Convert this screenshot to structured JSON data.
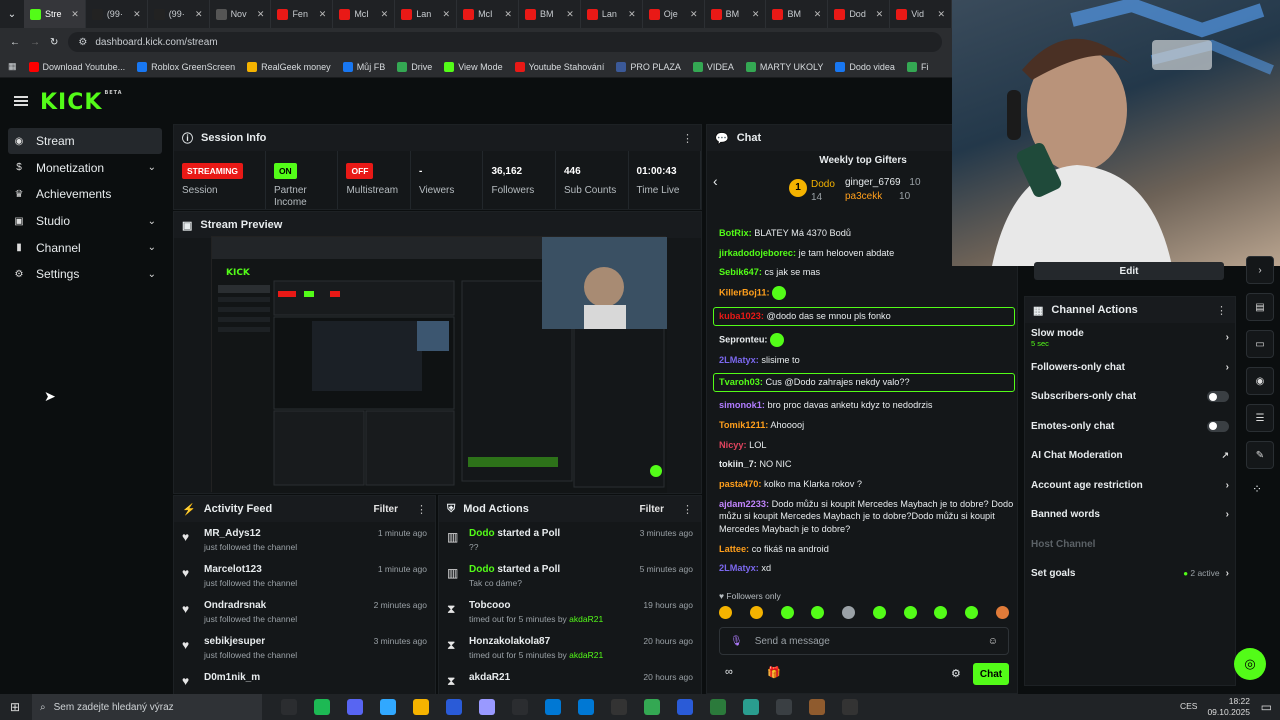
{
  "tabs": [
    "Stre",
    "(99·",
    "(99·",
    "Nov",
    "Fen",
    "McI",
    "Lan",
    "McI",
    "BM",
    "Lan",
    "Oje",
    "BM",
    "BM",
    "Dod",
    "Vid"
  ],
  "address": {
    "url": "dashboard.kick.com/stream"
  },
  "bookmarks": [
    "Download Youtube...",
    "Roblox GreenScreen",
    "RealGeek money",
    "Můj FB",
    "Drive",
    "View Mode",
    "Youtube Stahování",
    "PRO PLAZA",
    "VIDEA",
    "MARTY UKOLY",
    "Dodo videa",
    "Fi"
  ],
  "brand": {
    "logo": "KICK",
    "beta": "BETA",
    "accent": "#53fc18"
  },
  "sidebar": [
    {
      "label": "Stream",
      "chev": false
    },
    {
      "label": "Monetization",
      "chev": true
    },
    {
      "label": "Achievements",
      "chev": false
    },
    {
      "label": "Studio",
      "chev": true
    },
    {
      "label": "Channel",
      "chev": true
    },
    {
      "label": "Settings",
      "chev": true
    }
  ],
  "session": {
    "title": "Session Info",
    "stats": [
      {
        "value": "STREAMING",
        "label": "Session",
        "pill": "#e91916"
      },
      {
        "value": "ON",
        "label": "Partner Income",
        "pill": "#53fc18"
      },
      {
        "value": "OFF",
        "label": "Multistream",
        "pill": "#e91916"
      },
      {
        "value": "-",
        "label": "Viewers"
      },
      {
        "value": "36,162",
        "label": "Followers"
      },
      {
        "value": "446",
        "label": "Sub Counts"
      },
      {
        "value": "01:00:43",
        "label": "Time Live"
      }
    ]
  },
  "preview": {
    "title": "Stream Preview"
  },
  "activity": {
    "title": "Activity Feed",
    "filter": "Filter",
    "items": [
      {
        "name": "MR_Adys12",
        "sub": "just followed the channel",
        "time": "1 minute ago"
      },
      {
        "name": "Marcelot123",
        "sub": "just followed the channel",
        "time": "1 minute ago"
      },
      {
        "name": "Ondradrsnak",
        "sub": "just followed the channel",
        "time": "2 minutes ago"
      },
      {
        "name": "sebikjesuper",
        "sub": "just followed the channel",
        "time": "3 minutes ago"
      },
      {
        "name": "D0m1nik_m",
        "sub": "",
        "time": ""
      }
    ]
  },
  "mod": {
    "title": "Mod Actions",
    "filter": "Filter",
    "items": [
      {
        "icon": "poll",
        "name": "Dodo",
        "verb": "started a Poll",
        "sub": "??",
        "time": "3 minutes ago"
      },
      {
        "icon": "poll",
        "name": "Dodo",
        "verb": "started a Poll",
        "sub": "Tak co dáme?",
        "time": "5 minutes ago"
      },
      {
        "icon": "timer",
        "name": "Tobcooo",
        "verb": "",
        "sub": "timed out for 5 minutes by",
        "by": "akdaR21",
        "time": "19 hours ago"
      },
      {
        "icon": "timer",
        "name": "Honzakolakola87",
        "verb": "",
        "sub": "timed out for 5 minutes by",
        "by": "akdaR21",
        "time": "20 hours ago"
      },
      {
        "icon": "timer",
        "name": "akdaR21",
        "verb": "",
        "sub": "",
        "time": "20 hours ago"
      }
    ]
  },
  "chat": {
    "title": "Chat",
    "gifters_title": "Weekly top Gifters",
    "gifters": [
      {
        "rank": "1",
        "name": "Dodo",
        "count": "14"
      },
      {
        "name": "ginger_6769",
        "count": "10"
      },
      {
        "name": "pa3cekk",
        "count": "10"
      }
    ],
    "messages": [
      {
        "user": "BotRix:",
        "color": "#53fc18",
        "text": "BLATEY Má 4370 Bodů"
      },
      {
        "user": "jirkadodojeborec:",
        "color": "#53fc18",
        "text": "je tam helooven abdate"
      },
      {
        "user": "Sebik647:",
        "color": "#53fc18",
        "text": "cs jak se mas"
      },
      {
        "user": "KillerBoj11:",
        "color": "#ff9f1c",
        "text": "",
        "emote": true
      },
      {
        "user": "kuba1023:",
        "color": "#e91916",
        "text": "@dodo das se mnou pls fonko",
        "hl": true
      },
      {
        "user": "Sepronteu:",
        "color": "#e8ecee",
        "text": "",
        "emote": true
      },
      {
        "user": "2LMatyx:",
        "color": "#7b68ee",
        "text": "slisime to"
      },
      {
        "user": "Tvaroh03:",
        "color": "#53fc18",
        "text": "Cus @Dodo zahrajes nekdy valo??",
        "hl": true
      },
      {
        "user": "simonok1:",
        "color": "#b07cff",
        "text": "bro proc davas anketu kdyz to nedodrzis"
      },
      {
        "user": "Tomik1211:",
        "color": "#ff9f1c",
        "text": "Ahooooj"
      },
      {
        "user": "Nicyy:",
        "color": "#e0445e",
        "text": "LOL"
      },
      {
        "user": "tokiin_7:",
        "color": "#e8ecee",
        "text": "NO NIC"
      },
      {
        "user": "pasta470:",
        "color": "#ff9f1c",
        "text": "kolko ma Klarka rokov ?"
      },
      {
        "user": "ajdam2233:",
        "color": "#c084fc",
        "text": "Dodo můžu si koupit Mercedes Maybach je to dobre? Dodo můžu si koupit Mercedes Maybach je to dobre?Dodo můžu si koupit Mercedes Maybach je to dobre?"
      },
      {
        "user": "Lattee:",
        "color": "#ff9f1c",
        "text": "co fikáš na android"
      },
      {
        "user": "2LMatyx:",
        "color": "#7b68ee",
        "text": "xd"
      }
    ],
    "followers_only": "Followers only",
    "input_placeholder": "Send a message",
    "send_label": "Chat"
  },
  "channel_actions": {
    "edit": "Edit",
    "title": "Channel Actions",
    "items": [
      {
        "label": "Slow mode",
        "sub": "5 sec",
        "right": "chev"
      },
      {
        "label": "Followers-only chat",
        "right": "chev"
      },
      {
        "label": "Subscribers-only chat",
        "right": "toggle"
      },
      {
        "label": "Emotes-only chat",
        "right": "toggle"
      },
      {
        "label": "AI Chat Moderation",
        "right": "ext"
      },
      {
        "label": "Account age restriction",
        "right": "chev"
      },
      {
        "label": "Banned words",
        "right": "chev"
      },
      {
        "label": "Host Channel",
        "right": "",
        "disabled": true
      },
      {
        "label": "Set goals",
        "right": "chev",
        "badge": "2 active"
      }
    ]
  },
  "taskbar": {
    "search": "Sem zadejte hledaný výraz",
    "lang": "CES",
    "time": "18:22",
    "date": "09.10.2025"
  }
}
